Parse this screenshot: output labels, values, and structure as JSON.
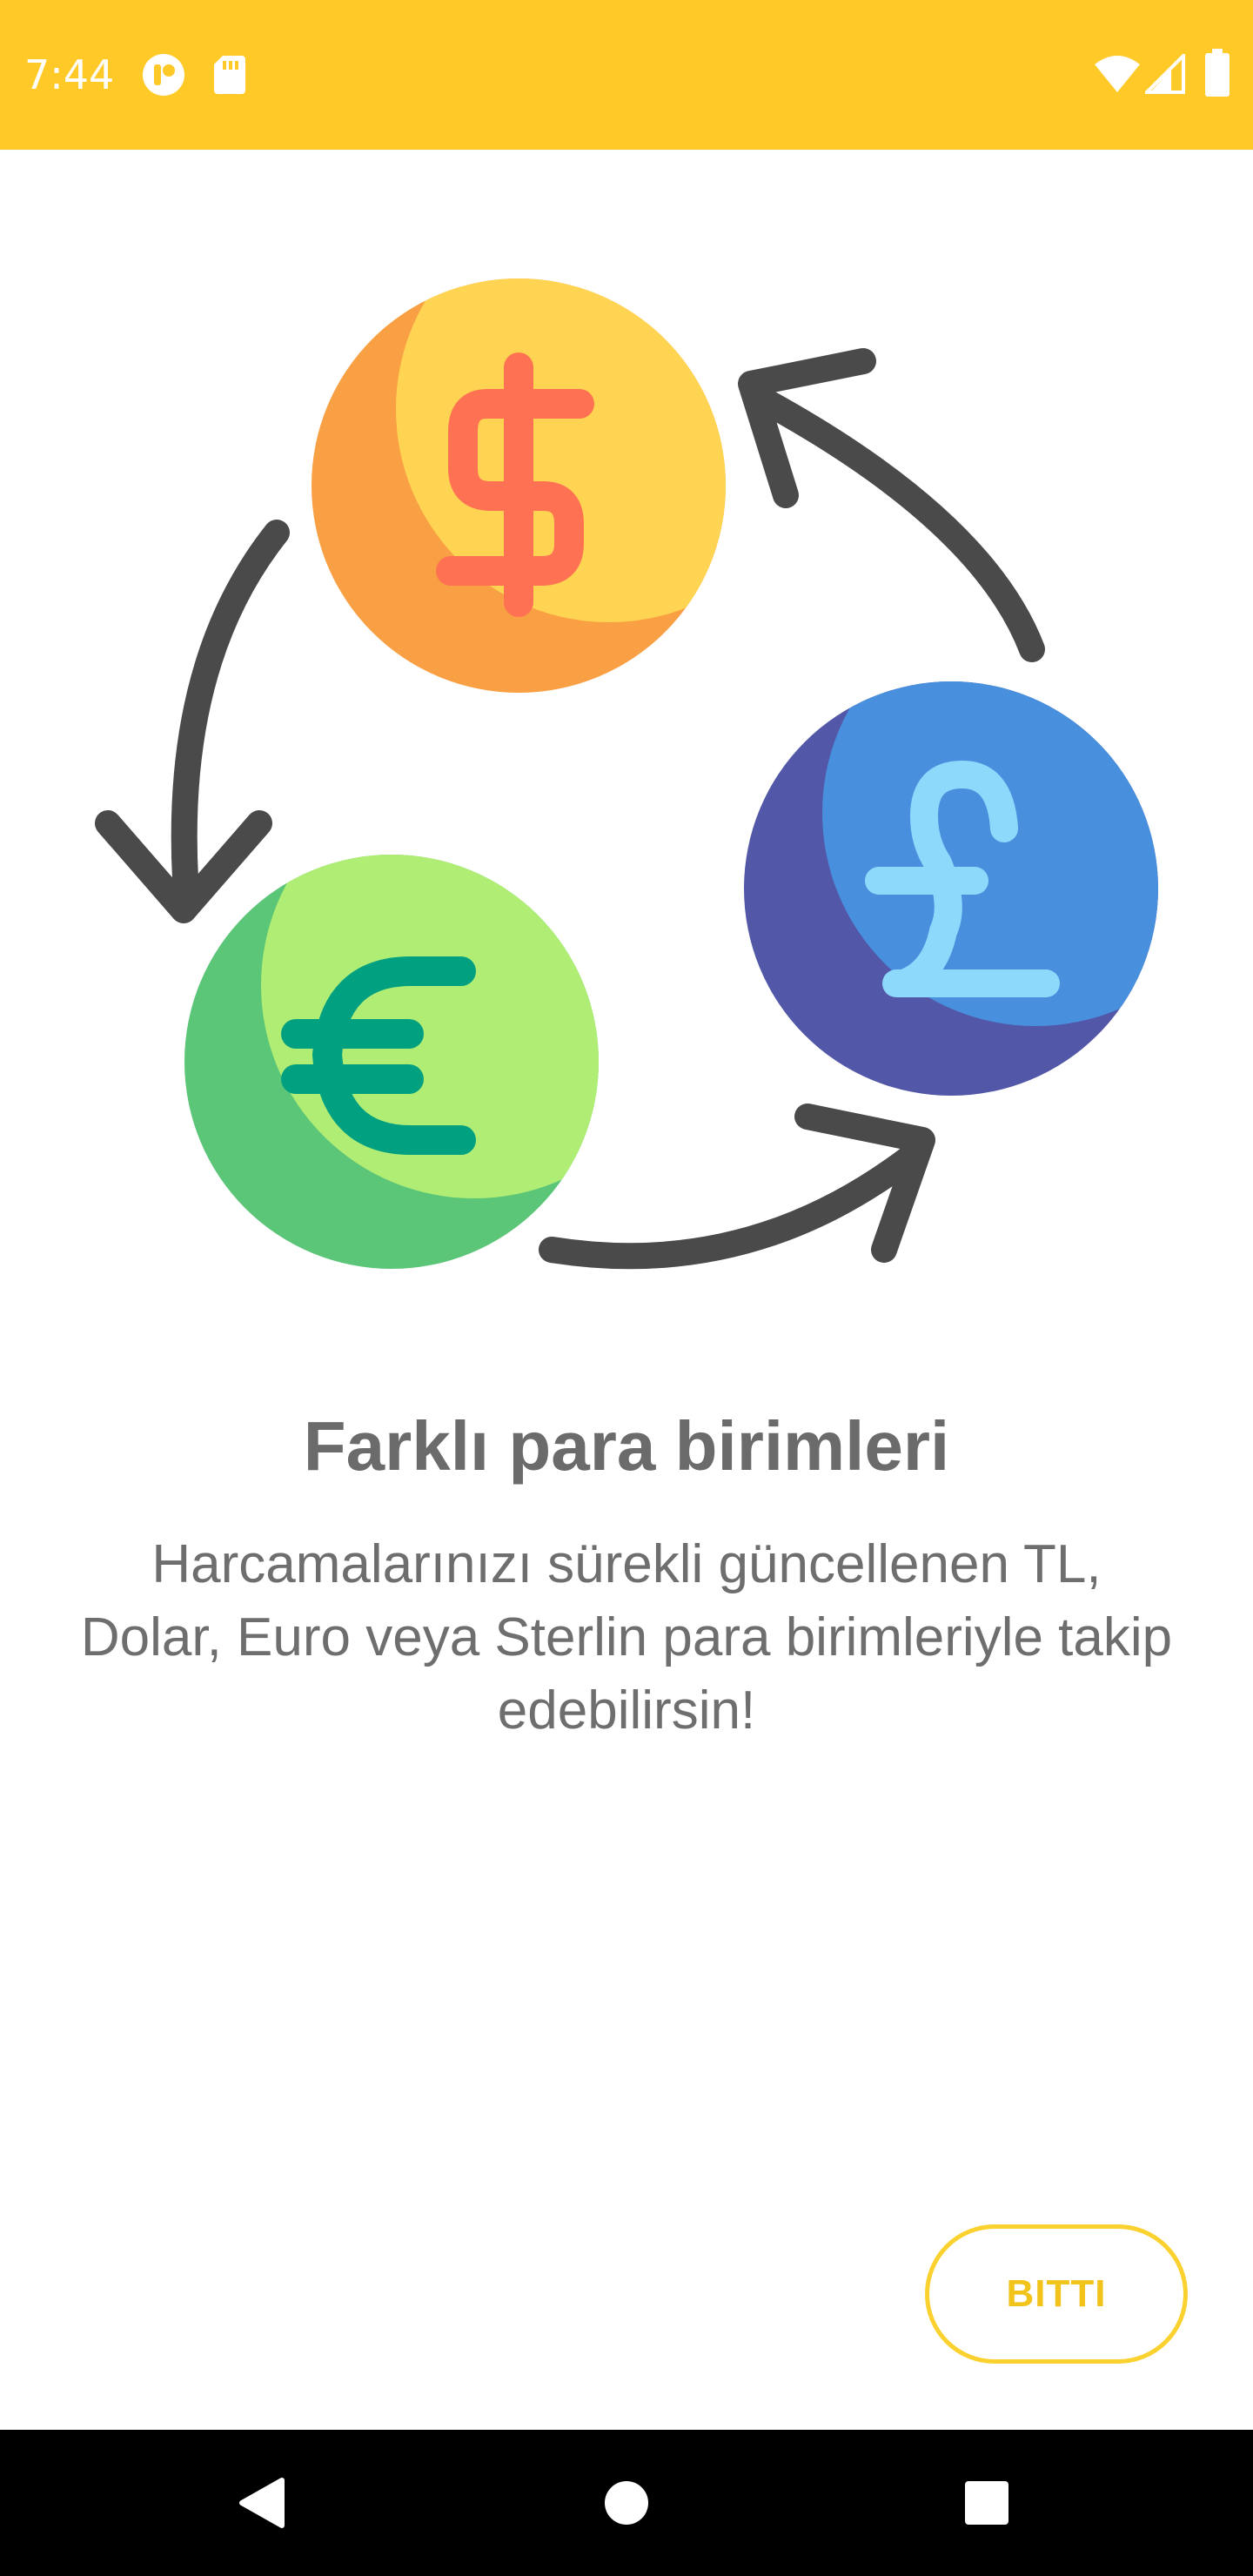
{
  "status_bar": {
    "time": "7:44",
    "background_color": "#FFCA28",
    "icons": [
      "notification-app-icon",
      "sd-card-icon",
      "wifi-icon",
      "cellular-signal-icon",
      "battery-icon"
    ]
  },
  "illustration": {
    "currencies": [
      {
        "name": "dollar-coin",
        "symbol": "$",
        "colors": [
          "#FFD452",
          "#F9A045",
          "#FE7153"
        ]
      },
      {
        "name": "pound-coin",
        "symbol": "£",
        "colors": [
          "#4890DD",
          "#5257A8",
          "#8DD9FC"
        ]
      },
      {
        "name": "euro-coin",
        "symbol": "€",
        "colors": [
          "#B0ED74",
          "#5CC678",
          "#00A081"
        ]
      }
    ],
    "arrow_color": "#4A4A4A"
  },
  "content": {
    "title": "Farklı para birimleri",
    "description": "Harcamalarınızı sürekli güncellenen TL, Dolar, Euro veya Sterlin para birimleriyle takip edebilirsin!"
  },
  "actions": {
    "done_label": "BITTI",
    "accent_color": "#FBD12F"
  },
  "nav_bar": {
    "buttons": [
      "back-icon",
      "home-icon",
      "recents-icon"
    ]
  }
}
